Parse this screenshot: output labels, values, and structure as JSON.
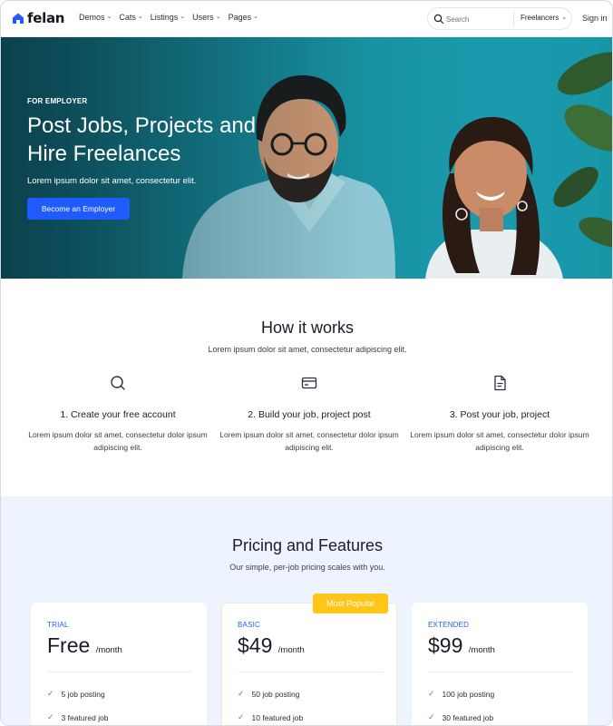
{
  "header": {
    "logo": "felan",
    "nav": [
      {
        "label": "Demos"
      },
      {
        "label": "Cats"
      },
      {
        "label": "Listings"
      },
      {
        "label": "Users"
      },
      {
        "label": "Pages"
      }
    ],
    "search": {
      "placeholder": "Search",
      "category": "Freelancers"
    },
    "signin": "Sign in"
  },
  "hero": {
    "eyebrow": "FOR EMPLOYER",
    "title": "Post Jobs, Projects and Hire Freelances",
    "subtitle": "Lorem ipsum dolor sit amet, consectetur elit.",
    "button": "Become an Employer"
  },
  "how": {
    "title": "How it works",
    "subtitle": "Lorem ipsum dolor sit amet, consectetur adipiscing elit.",
    "steps": [
      {
        "icon": "search-icon",
        "title": "1. Create your free account",
        "text": "Lorem ipsum dolor sit amet, consectetur dolor ipsum adipiscing elit."
      },
      {
        "icon": "credit-card-icon",
        "title": "2. Build your job, project post",
        "text": "Lorem ipsum dolor sit amet, consectetur dolor ipsum adipiscing elit."
      },
      {
        "icon": "document-icon",
        "title": "3. Post your job, project",
        "text": "Lorem ipsum dolor sit amet, consectetur dolor ipsum adipiscing elit."
      }
    ]
  },
  "pricing": {
    "title": "Pricing and Features",
    "subtitle": "Our simple, per-job pricing scales with you.",
    "plans": [
      {
        "name": "TRIAL",
        "price": "Free",
        "per": "/month",
        "features": [
          "5 job posting",
          "3 featured job"
        ]
      },
      {
        "name": "BASIC",
        "price": "$49",
        "per": "/month",
        "badge": "Most Popular",
        "features": [
          "50 job posting",
          "10 featured job"
        ]
      },
      {
        "name": "EXTENDED",
        "price": "$99",
        "per": "/month",
        "features": [
          "100 job posting",
          "30 featured job"
        ]
      }
    ]
  },
  "colors": {
    "accent": "#1f5bff",
    "badge": "#ffc61a",
    "check": "#2fa84f",
    "hero_bg": "#178f9f"
  }
}
